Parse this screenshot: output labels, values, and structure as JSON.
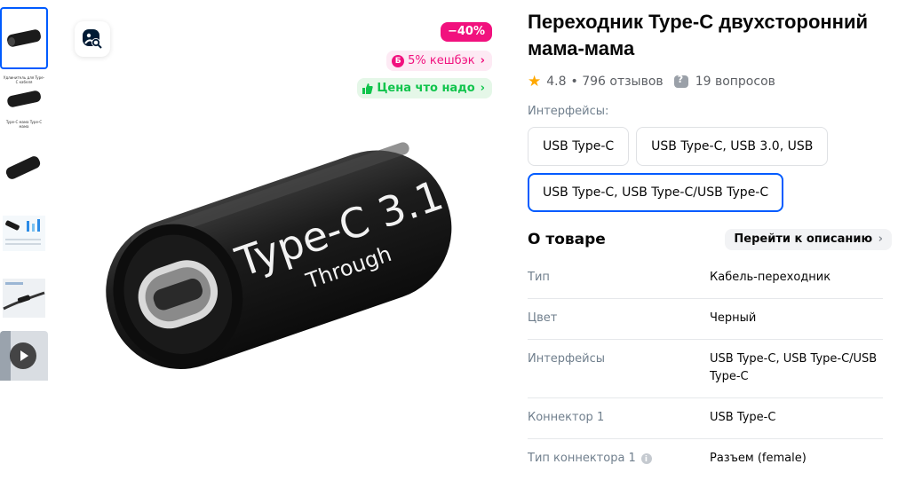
{
  "gallery": {
    "thumbnails": [
      {
        "name": "thumb-product-main",
        "active": true
      },
      {
        "name": "thumb-product-caption",
        "caption_top": "Удлинитель для Type-C кабеля",
        "caption_bottom": "Type-C мама Type-C мама"
      },
      {
        "name": "thumb-product-angle"
      },
      {
        "name": "thumb-specification"
      },
      {
        "name": "thumb-in-use"
      },
      {
        "name": "thumb-video"
      }
    ],
    "badges": {
      "discount": "−40%",
      "cashback_icon": "Б",
      "cashback": "5% кешбэк",
      "good_price": "Цена что надо"
    },
    "product_print": {
      "line1": "Type-C 3.1",
      "line2": "Through"
    }
  },
  "product": {
    "title": "Переходник Type-C двухсторонний мама-мама",
    "rating": "4.8",
    "reviews": "• 796 отзывов",
    "questions": "19 вопросов"
  },
  "interfaces": {
    "label": "Интерфейсы:",
    "options": [
      {
        "label": "USB Type-C",
        "selected": false
      },
      {
        "label": "USB Type-C, USB 3.0, USB",
        "selected": false
      },
      {
        "label": "USB Type-C, USB Type-C/USB Type-C",
        "selected": true
      }
    ]
  },
  "about": {
    "title": "О товаре",
    "go_to_description": "Перейти к описанию",
    "specs": [
      {
        "key": "Тип",
        "value": "Кабель-переходник"
      },
      {
        "key": "Цвет",
        "value": "Черный"
      },
      {
        "key": "Интерфейсы",
        "value": "USB Type-C, USB Type-C/USB Type-C"
      },
      {
        "key": "Коннектор 1",
        "value": "USB Type-C"
      },
      {
        "key": "Тип коннектора 1",
        "value": "Разъем (female)"
      }
    ]
  },
  "colors": {
    "accent": "#005bff",
    "discount": "#f1117e",
    "good_price": "#10c44c",
    "star": "#ffa800"
  }
}
